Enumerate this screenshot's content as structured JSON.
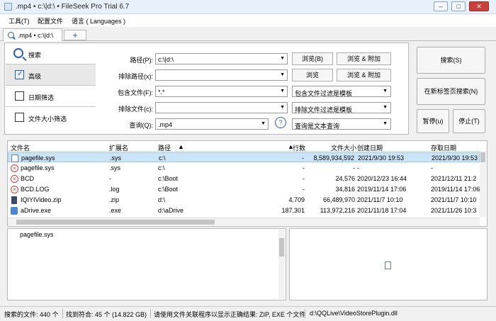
{
  "window": {
    "title": ".mp4 • c:\\|d:\\ • FileSeek Pro Trial 6.7"
  },
  "menu": [
    "工具(T)",
    "配置文件",
    "语言 ( Languages )"
  ],
  "tab": {
    "label": ".mp4 • c:\\|d:\\",
    "new_tab": "+"
  },
  "nav": {
    "search": "搜索",
    "advanced": "高级",
    "date_filter": "日期筛选",
    "size_filter": "文件大小筛选"
  },
  "form": {
    "path_label": "路径(P):",
    "path_value": "c:\\|d:\\",
    "exclude_path_label": "排除路径(x):",
    "exclude_path_value": "",
    "include_files_label": "包含文件(F):",
    "include_files_value": "*.*",
    "exclude_files_label": "排除文件(c):",
    "exclude_files_value": "",
    "query_label": "查询(Q):",
    "query_value": ".mp4",
    "browse_b": "浏览(B)",
    "browse_add_1": "浏览 & 附加",
    "browse": "浏览",
    "browse_add_2": "浏览 & 附加",
    "include_filter": "包含文件过滤是模板",
    "exclude_filter": "排除文件过滤是模板",
    "query_filter": "查询是文本查询",
    "help": "?"
  },
  "actions": {
    "search": "搜索(S)",
    "new_tab_search": "在新标签页搜索(N)",
    "pause": "暂停(u)",
    "stop": "停止(T)"
  },
  "table": {
    "headers": [
      "文件名",
      "扩展名",
      "路径",
      "行数",
      "文件大小",
      "创建日期",
      "存取日期"
    ],
    "rows": [
      {
        "icon": "doc",
        "name": "pagefile.sys",
        "ext": ".sys",
        "path": "c:\\",
        "lines": "-",
        "size": "8,589,934,592",
        "created": "2021/9/30 19:53",
        "accessed": "2021/9/30 19:53"
      },
      {
        "icon": "err",
        "name": "pagefile.sys",
        "ext": ".sys",
        "path": "c:\\",
        "lines": "-",
        "size": "-",
        "created": "-",
        "accessed": "-"
      },
      {
        "icon": "err",
        "name": "BCD",
        "ext": "-",
        "path": "c:\\Boot",
        "lines": "-",
        "size": "24,576",
        "created": "2020/12/23 16:44",
        "accessed": "2021/12/11 21:2"
      },
      {
        "icon": "err",
        "name": "BCD.LOG",
        "ext": ".log",
        "path": "c:\\Boot",
        "lines": "-",
        "size": "34,816",
        "created": "2019/11/14 17:06",
        "accessed": "2019/11/14 17:06"
      },
      {
        "icon": "zip",
        "name": "IQIYIVideo.zip",
        "ext": ".zip",
        "path": "d:\\",
        "lines": "4,709",
        "size": "66,489,970",
        "created": "2021/11/7 10:10",
        "accessed": "2021/11/7 10:10"
      },
      {
        "icon": "exe",
        "name": "aDrive.exe",
        "ext": ".exe",
        "path": "d:\\aDrive",
        "lines": "187,301",
        "size": "113,972,216",
        "created": "2021/11/18 17:04",
        "accessed": "2021/11/26 10:3"
      }
    ]
  },
  "preview": {
    "filename": "pagefile.sys"
  },
  "status": {
    "searched": "搜索的文件: 440 个",
    "found": "找到符合: 45 个 (14.822 GB)",
    "hint": "请使用文件关联程序以显示正确结果: ZIP, EXE 个文件",
    "path": "d:\\QQLive\\VideoStorePlugin.dll"
  }
}
